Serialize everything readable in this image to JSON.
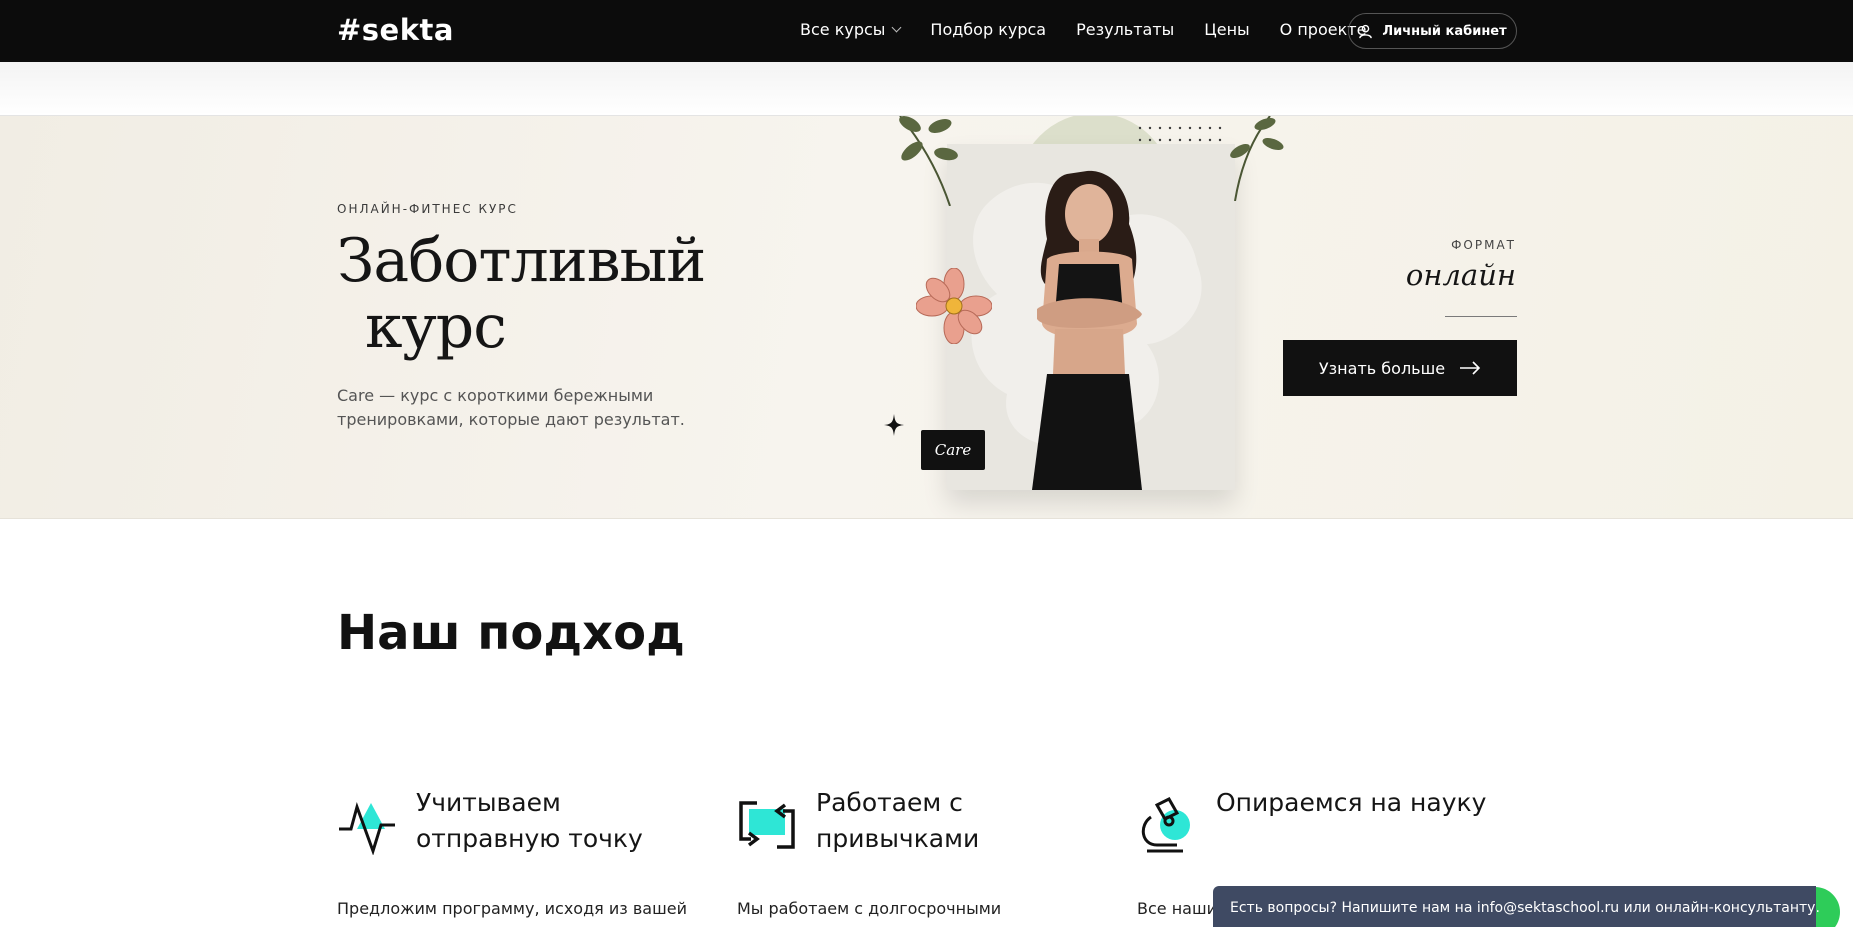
{
  "nav": {
    "logo": "#sekta",
    "items": [
      {
        "label": "Все курсы",
        "has_dropdown": true
      },
      {
        "label": "Подбор курса"
      },
      {
        "label": "Результаты"
      },
      {
        "label": "Цены"
      },
      {
        "label": "О проекте"
      }
    ],
    "cabinet_label": "Личный кабинет"
  },
  "hero": {
    "eyebrow": "ОНЛАЙН-ФИТНЕС КУРС",
    "title_line1": "Заботливый",
    "title_line2": "курс",
    "description": "Care — курс с короткими бережными тренировками, которые дают результат.",
    "care_tag": "Care",
    "format_label": "ФОРМАТ",
    "format_value": "онлайн",
    "cta_label": "Узнать больше"
  },
  "approach": {
    "title": "Наш подход",
    "features": [
      {
        "title": "Учитываем отправную точку",
        "text": "Предложим программу, исходя из вашей",
        "icon": "pulse-icon"
      },
      {
        "title": "Работаем с привычками",
        "text": "Мы работаем с долгосрочными",
        "icon": "loop-icon"
      },
      {
        "title": "Опираемся на науку",
        "text": "Все наши",
        "icon": "microscope-icon"
      }
    ]
  },
  "chat": {
    "text": "Есть вопросы? Напишите нам на info@sektaschool.ru или онлайн-консультанту."
  },
  "colors": {
    "nav_bg": "#0c0c0c",
    "accent_cyan": "#2ee6d6",
    "chat_bg": "#3f4a63",
    "chat_bubble": "#2ecc59"
  }
}
